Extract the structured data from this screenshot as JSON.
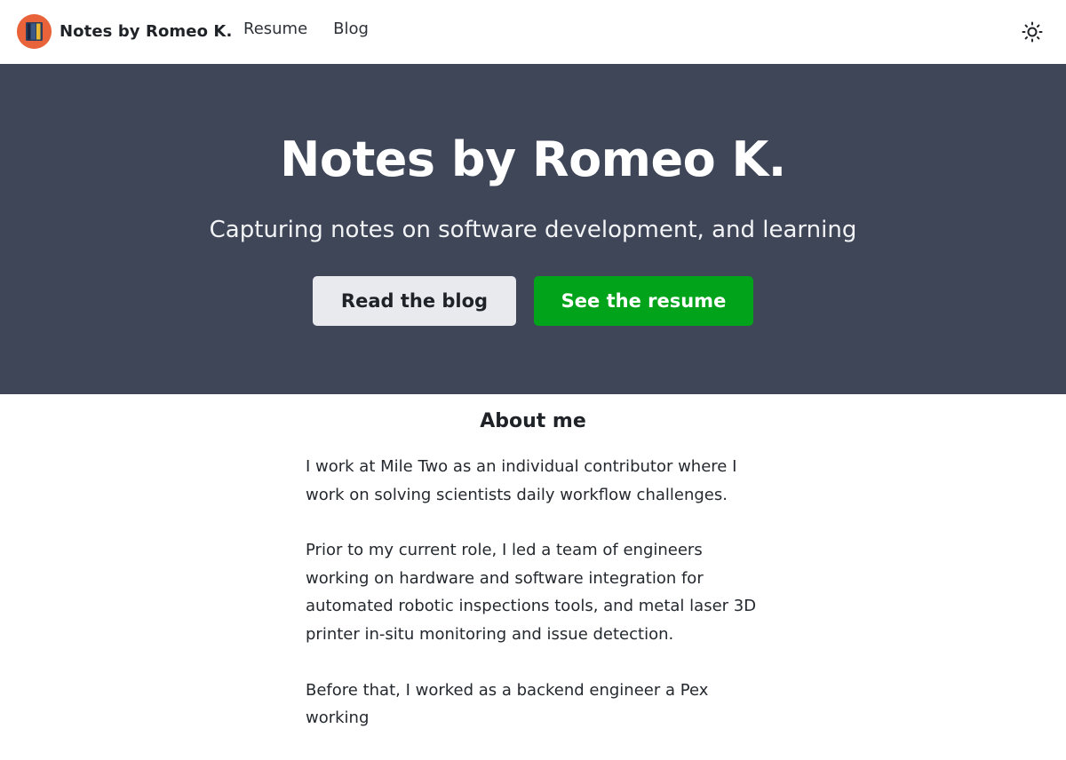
{
  "header": {
    "brand_name": "Notes by Romeo K.",
    "nav": [
      {
        "label": "Resume"
      },
      {
        "label": "Blog"
      }
    ],
    "theme_icon": "sun-icon",
    "logo_icon": "notebook-logo-icon"
  },
  "hero": {
    "title": "Notes by Romeo K.",
    "subtitle": "Capturing notes on software development, and learning",
    "buttons": {
      "blog": "Read the blog",
      "resume": "See the resume"
    }
  },
  "about": {
    "heading": "About me",
    "paragraphs": [
      "I work at Mile Two as an individual contributor where I work on solving scientists daily workflow challenges.",
      "Prior to my current role, I led a team of engineers working on hardware and software integration for automated robotic inspections tools, and metal laser 3D printer in-situ monitoring and issue detection.",
      "Before that, I worked as a backend engineer a Pex working"
    ]
  },
  "colors": {
    "hero_bg": "#3e4658",
    "accent_green": "#00a31a",
    "logo_orange": "#e8623a"
  }
}
